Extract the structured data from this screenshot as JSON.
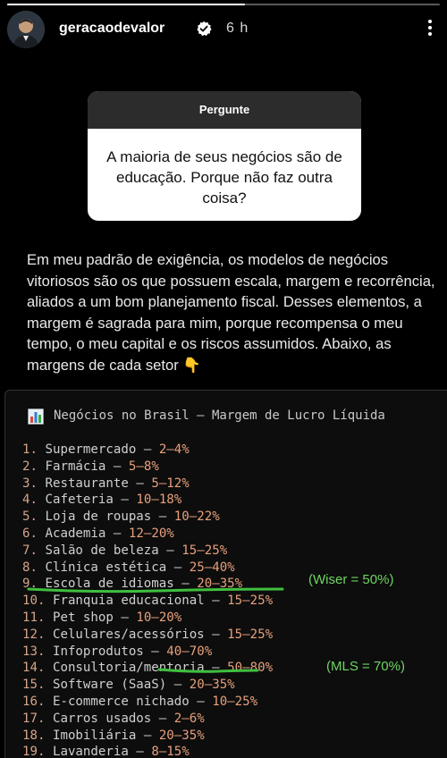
{
  "header": {
    "username": "geracaodevalor",
    "time": "6 h",
    "progress_fraction": 0.55
  },
  "question": {
    "label": "Pergunte",
    "text": "A maioria de seus negócios são de educação. Porque não faz outra coisa?"
  },
  "answer": {
    "text": "Em meu padrão de exigência, os modelos de negócios vitoriosos são os que possuem escala, margem e recorrência, aliados a um bom planejamento fiscal. Desses elementos, a margem é sagrada para mim, porque recompensa o meu tempo, o meu capital e os riscos assumidos. Abaixo, as margens de cada setor",
    "emoji": "👇"
  },
  "code": {
    "title": "Negócios no Brasil — Margem de Lucro Líquida",
    "items": [
      {
        "num": "1.",
        "name": "Supermercado",
        "range": "2–4%"
      },
      {
        "num": "2.",
        "name": "Farmácia",
        "range": "5–8%"
      },
      {
        "num": "3.",
        "name": "Restaurante",
        "range": "5–12%"
      },
      {
        "num": "4.",
        "name": "Cafeteria",
        "range": "10–18%"
      },
      {
        "num": "5.",
        "name": "Loja de roupas",
        "range": "10–22%"
      },
      {
        "num": "6.",
        "name": "Academia",
        "range": "12–20%"
      },
      {
        "num": "7.",
        "name": "Salão de beleza",
        "range": "15–25%"
      },
      {
        "num": "8.",
        "name": "Clínica estética",
        "range": "25–40%"
      },
      {
        "num": "9.",
        "name": "Escola de idiomas",
        "range": "20–35%"
      },
      {
        "num": "10.",
        "name": "Franquia educacional",
        "range": "15–25%"
      },
      {
        "num": "11.",
        "name": "Pet shop",
        "range": "10–20%"
      },
      {
        "num": "12.",
        "name": "Celulares/acessórios",
        "range": "15–25%"
      },
      {
        "num": "13.",
        "name": "Infoprodutos",
        "range": "40–70%"
      },
      {
        "num": "14.",
        "name": "Consultoria/mentoria",
        "range": "50–80%"
      },
      {
        "num": "15.",
        "name": "Software (SaaS)",
        "range": "20–35%"
      },
      {
        "num": "16.",
        "name": "E-commerce nichado",
        "range": "10–25%"
      },
      {
        "num": "17.",
        "name": "Carros usados",
        "range": "2–6%"
      },
      {
        "num": "18.",
        "name": "Imobiliária",
        "range": "20–35%"
      },
      {
        "num": "19.",
        "name": "Lavanderia",
        "range": "8–15%"
      }
    ],
    "separator": "—",
    "notes": {
      "wiser": "(Wiser = 50%)",
      "mls": "(MLS = 70%)"
    }
  },
  "colors": {
    "number": "#d6a58a",
    "value": "#e8a07c",
    "note": "#6ed464",
    "underline": "#3fbf3f"
  },
  "icons": {
    "verified": "verified-badge-icon",
    "more": "more-options-icon",
    "chart": "bar-chart-icon",
    "emoji": "pointing-down-hand-emoji"
  }
}
